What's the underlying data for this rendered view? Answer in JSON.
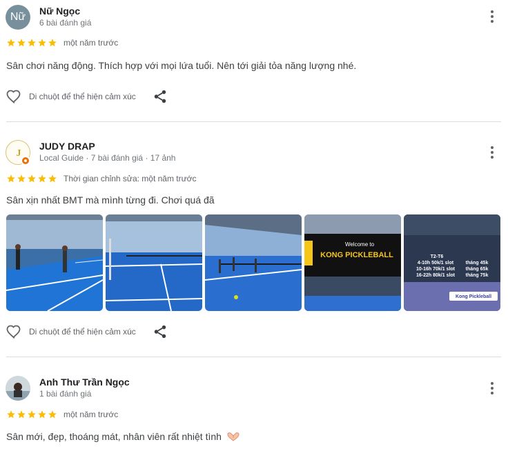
{
  "reviews": [
    {
      "avatar_initials": "Nữ",
      "name": "Nữ Ngọc",
      "meta": "6 bài đánh giá",
      "rating": 5,
      "time": "một năm trước",
      "text": "Sân chơi năng động. Thích hợp với mọi lứa tuổi. Nên tới giải tỏa năng lượng nhé.",
      "react_label": "Di chuột để thể hiện cảm xúc"
    },
    {
      "name": "JUDY DRAP",
      "meta": "Local Guide · 7 bài đánh giá · 17 ảnh",
      "rating": 5,
      "time": "Thời gian chỉnh sửa: một năm trước",
      "text": "Sân xịn nhất BMT mà mình từng đi. Chơi quá đã",
      "react_label": "Di chuột để thể hiện cảm xúc",
      "photos": [
        {
          "icon": "court-photo"
        },
        {
          "icon": "court-photo"
        },
        {
          "icon": "court-photo"
        },
        {
          "icon": "banner-photo",
          "banner_top": "Welcome to",
          "banner_main": "KONG PICKLEBALL"
        },
        {
          "icon": "price-photo",
          "price_title": "T2-T6",
          "price_lines": [
            "4-10h 50k/1 slot",
            "10-16h 70k/1 slot",
            "16-22h 80k/1 slot"
          ],
          "month_lines": [
            "tháng 45k",
            "tháng 65k",
            "tháng 75k"
          ],
          "brand": "Kong Pickleball"
        }
      ]
    },
    {
      "name": "Anh Thư Trần Ngọc",
      "meta": "1 bài đánh giá",
      "rating": 5,
      "time": "một năm trước",
      "text": "Sân mới, đẹp, thoáng mát, nhân viên rất nhiệt tình"
    }
  ],
  "colors": {
    "star": "#fbbc04",
    "court_blue": "#1e6fd9",
    "banner_yellow": "#f5c518"
  }
}
